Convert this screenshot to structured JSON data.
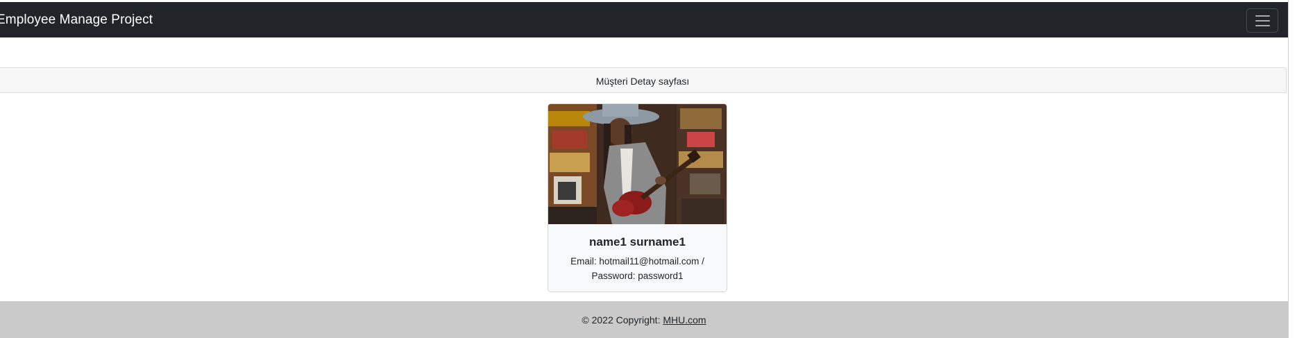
{
  "navbar": {
    "brand": "Employee Manage Project",
    "toggler_icon": "hamburger-menu-icon"
  },
  "header": {
    "title": "Müşteri Detay sayfası"
  },
  "profile": {
    "name": "name1 surname1",
    "email_line": "Email: hotmail11@hotmail.com /",
    "password_line": "Password: password1",
    "photo_description": "woman in hat playing red electric guitar"
  },
  "footer": {
    "copyright_prefix": "© 2022 Copyright: ",
    "link_text": "MHU.com"
  },
  "colors": {
    "navbar_bg": "#212529",
    "footer_bg": "#cacaca",
    "header_bg": "#f7f7f7"
  }
}
